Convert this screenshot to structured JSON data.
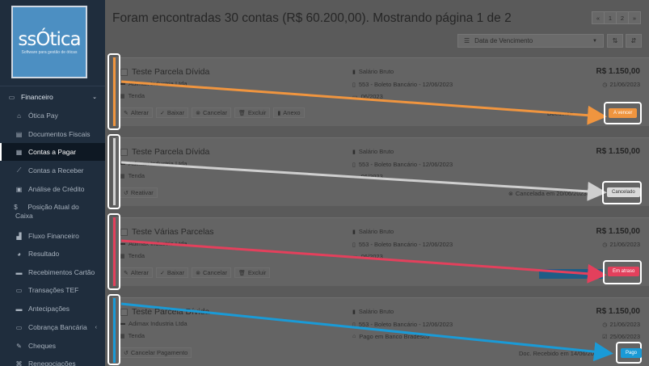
{
  "app": {
    "logo_text": "ssÓtica",
    "logo_tagline": "Software para gestão de óticas"
  },
  "sidebar": {
    "section": {
      "label": "Financeiro",
      "icon": "money-icon"
    },
    "items": [
      {
        "label": "Ótica Pay",
        "icon": "bank-icon"
      },
      {
        "label": "Documentos Fiscais",
        "icon": "document-icon"
      },
      {
        "label": "Contas a Pagar",
        "icon": "calculator-icon",
        "active": true
      },
      {
        "label": "Contas a Receber",
        "icon": "chart-icon"
      },
      {
        "label": "Análise de Crédito",
        "icon": "id-card-icon"
      },
      {
        "label": "Posição Atual do Caixa",
        "icon": "dollar-icon"
      },
      {
        "label": "Fluxo Financeiro",
        "icon": "bar-chart-icon"
      },
      {
        "label": "Resultado",
        "icon": "pie-chart-icon"
      },
      {
        "label": "Recebimentos Cartão",
        "icon": "card-icon"
      },
      {
        "label": "Transações TEF",
        "icon": "transfer-icon"
      },
      {
        "label": "Antecipações",
        "icon": "card-icon"
      },
      {
        "label": "Cobrança Bancária",
        "icon": "wallet-icon"
      },
      {
        "label": "Cheques",
        "icon": "edit-icon"
      },
      {
        "label": "Renegociações",
        "icon": "handshake-icon"
      }
    ]
  },
  "main": {
    "heading": "Foram encontradas 30 contas (R$ 60.200,00). Mostrando página 1 de 2",
    "pager": [
      "«",
      "1",
      "2",
      "»"
    ],
    "sort_select": "Data de Vencimento"
  },
  "cards": [
    {
      "title": "Teste Parcela Dívida",
      "supplier": "Adimax Industria Ltda",
      "store": "Tenda",
      "category": "Salário Bruto",
      "payment": "553 - Boleto Bancário - 12/06/2023",
      "extra": "06/2023",
      "amount": "R$ 1.150,00",
      "date": "21/06/2023",
      "actions": [
        "Alterar",
        "Baixar",
        "Cancelar",
        "Excluir",
        "Anexo"
      ],
      "note": "Documen",
      "status": "A vencer",
      "status_color": "#f0953f",
      "strip_color": "#f0953f"
    },
    {
      "title": "Teste Parcela Dívida",
      "supplier": "Adimax Industria Ltda",
      "store": "Tenda",
      "category": "Salário Bruto",
      "payment": "553 - Boleto Bancário - 12/06/2023",
      "extra": "06/2023",
      "amount": "R$ 1.150,00",
      "date": "",
      "actions": [
        "Reativar"
      ],
      "note": "Cancelada em 20/06/2023 às",
      "status": "Cancelado",
      "status_color": "#d2d2d2",
      "strip_color": "#d2d2d2"
    },
    {
      "title": "Teste Várias Parcelas",
      "supplier": "Adimax Industria Ltda",
      "store": "Tenda",
      "category": "Salário Bruto",
      "payment": "553 - Boleto Bancário - 12/06/2023",
      "extra": "06/2023",
      "amount": "R$ 1.150,00",
      "date": "21/06/2023",
      "actions": [
        "Alterar",
        "Baixar",
        "Cancelar",
        "Excluir"
      ],
      "note": "",
      "status": "Em atraso",
      "status_color": "#e3405c",
      "strip_color": "#e3405c"
    },
    {
      "title": "Teste Parcela Dívida",
      "supplier": "Adimax Industria Ltda",
      "store": "Tenda",
      "category": "Salário Bruto",
      "payment": "553 - Boleto Bancário - 12/06/2023",
      "extra": "Pago em Banco Bradesco",
      "amount": "R$ 1.150,00",
      "date": "21/06/2023",
      "date2": "25/06/2023",
      "actions": [
        "Cancelar Pagamento"
      ],
      "note": "Doc. Recebido em 14/06/2023",
      "status": "Pago",
      "status_color": "#1a9ad6",
      "strip_color": "#1a9ad6"
    }
  ]
}
